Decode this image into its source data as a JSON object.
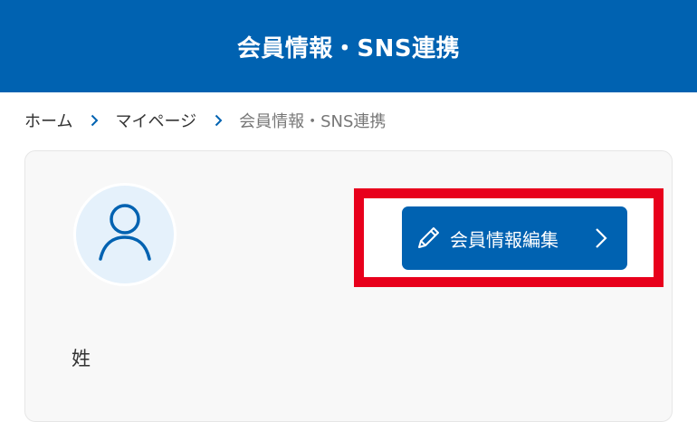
{
  "header": {
    "title": "会員情報・SNS連携"
  },
  "breadcrumb": {
    "items": [
      "ホーム",
      "マイページ"
    ],
    "current": "会員情報・SNS連携"
  },
  "profile": {
    "avatar_icon": "user-icon",
    "edit_button_label": "会員情報編集",
    "edit_button_icon": "pencil-icon",
    "field_label": "姓"
  },
  "colors": {
    "brand": "#0062b1",
    "highlight": "#e8001c",
    "card_background": "#f8f8f8",
    "avatar_background": "#e5f1fb"
  }
}
